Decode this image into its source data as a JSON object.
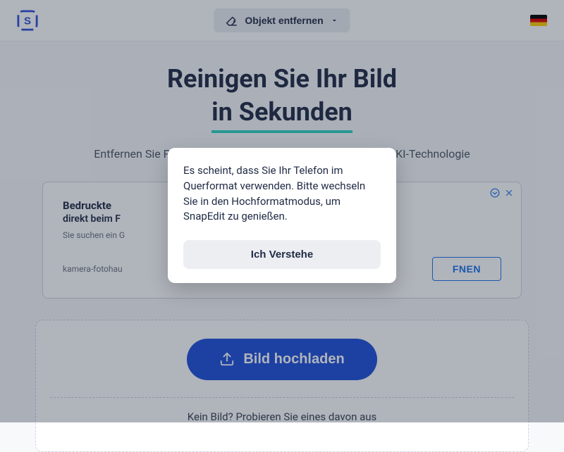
{
  "header": {
    "dropdown_label": "Objekt entfernen"
  },
  "hero": {
    "line1": "Reinigen Sie Ihr Bild",
    "line2": "in Sekunden",
    "subtitle": "Entfernen Sie Personen, Objekte schneller aus dem Foto mit KI-Technologie"
  },
  "ad": {
    "title": "Bedruckte",
    "subtitle": "direkt beim F",
    "desc": "Sie suchen ein G",
    "source": "kamera-fotohau",
    "open_label": "FNEN",
    "info_icon": "ⓘ"
  },
  "upload": {
    "button_label": "Bild hochladen",
    "no_image_text": "Kein Bild? Probieren Sie eines davon aus"
  },
  "modal": {
    "message": "Es scheint, dass Sie Ihr Telefon im Querformat verwenden. Bitte wechseln Sie in den Hochformatmodus, um SnapEdit zu genießen.",
    "confirm_label": "Ich Verstehe"
  }
}
